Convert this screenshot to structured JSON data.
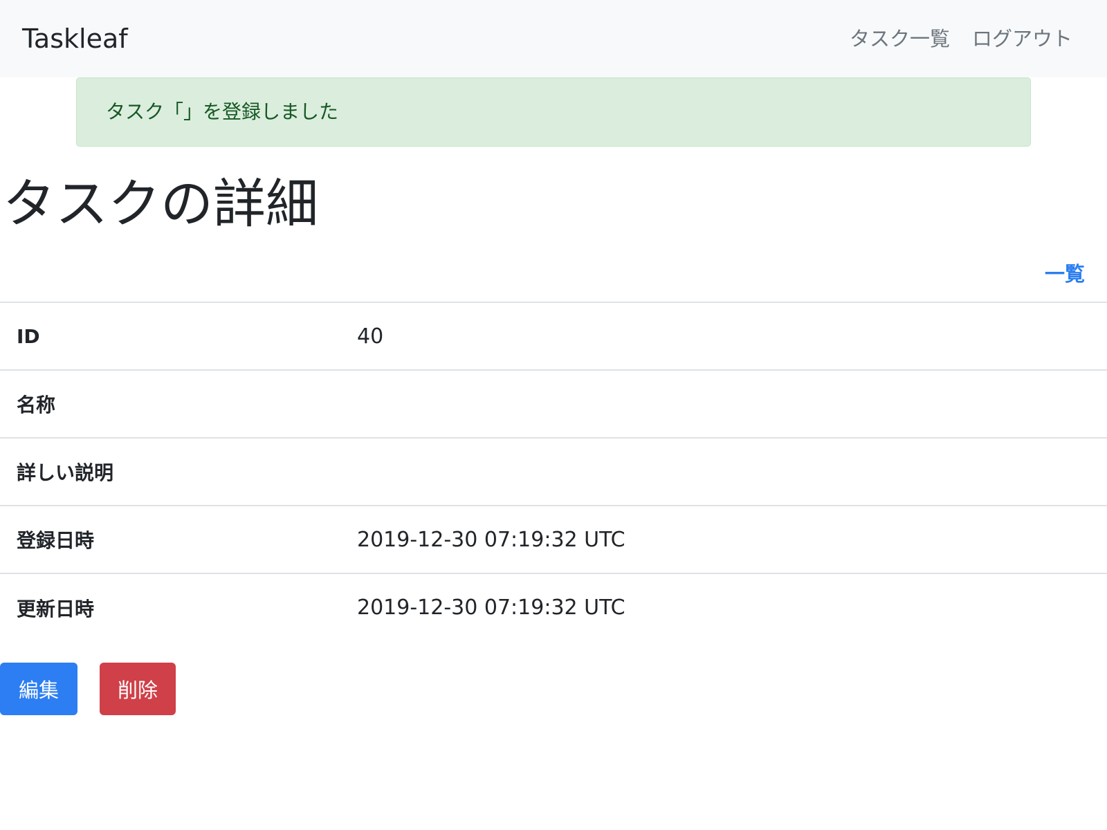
{
  "navbar": {
    "brand": "Taskleaf",
    "links": [
      {
        "label": "タスク一覧"
      },
      {
        "label": "ログアウト"
      }
    ]
  },
  "flash": {
    "message": "タスク「」を登録しました"
  },
  "page": {
    "title": "タスクの詳細",
    "list_link": "一覧"
  },
  "detail": {
    "rows": [
      {
        "label": "ID",
        "value": "40"
      },
      {
        "label": "名称",
        "value": ""
      },
      {
        "label": "詳しい説明",
        "value": ""
      },
      {
        "label": "登録日時",
        "value": "2019-12-30 07:19:32 UTC"
      },
      {
        "label": "更新日時",
        "value": "2019-12-30 07:19:32 UTC"
      }
    ]
  },
  "actions": {
    "edit_label": "編集",
    "delete_label": "削除"
  },
  "colors": {
    "navbar_bg": "#f8f9fa",
    "alert_bg": "#dbeddc",
    "alert_text": "#155724",
    "link": "#2b7ef0",
    "edit_button": "#2c7ef2",
    "delete_button": "#cf4049"
  }
}
